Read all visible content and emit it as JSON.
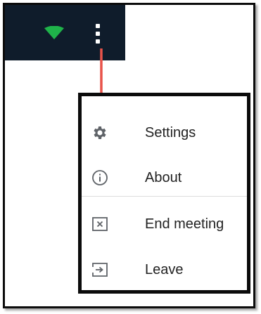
{
  "menu": {
    "items": [
      {
        "label": "Settings",
        "icon": "gear-icon"
      },
      {
        "label": "About",
        "icon": "info-icon"
      },
      {
        "label": "End meeting",
        "icon": "close-box-icon"
      },
      {
        "label": "Leave",
        "icon": "exit-icon"
      }
    ]
  },
  "colors": {
    "topbar": "#0f1c2b",
    "wifi": "#1fb34a",
    "arrow": "#e8534a",
    "icon": "#5f6368"
  }
}
